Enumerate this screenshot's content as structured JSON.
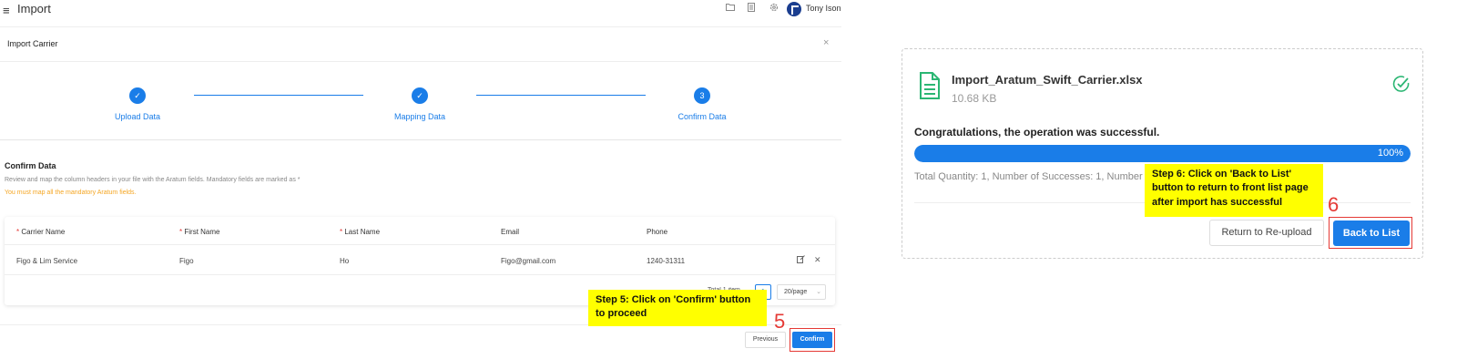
{
  "topbar": {
    "menu_icon": "≡",
    "app_title": "Import",
    "icons": [
      "folder-icon",
      "document-icon",
      "gear-icon"
    ],
    "user_name": "Tony Ison"
  },
  "modal": {
    "title": "Import Carrier",
    "close": "×"
  },
  "steps": [
    {
      "label": "Upload Data",
      "status": "done"
    },
    {
      "label": "Mapping Data",
      "status": "done"
    },
    {
      "label": "Confirm Data",
      "status": "current",
      "number": "3"
    }
  ],
  "confirm": {
    "title": "Confirm Data",
    "description": "Review and map the column headers in your file with the Aratum fields. Mandatory fields are marked as *",
    "warning": "You must map all the mandatory Aratum fields."
  },
  "table": {
    "columns": [
      {
        "label": "Carrier Name",
        "required": "*"
      },
      {
        "label": "First Name",
        "required": "*"
      },
      {
        "label": "Last Name",
        "required": "*"
      },
      {
        "label": "Email",
        "required": ""
      },
      {
        "label": "Phone",
        "required": ""
      }
    ],
    "rows": [
      {
        "carrier_name": "Figo & Lim Service",
        "first_name": "Figo",
        "last_name": "Ho",
        "email": "Figo@gmail.com",
        "phone": "1240-31311"
      }
    ]
  },
  "pagination": {
    "total_text": "Total 1 item",
    "current_page": "1",
    "page_size": "20/page"
  },
  "buttons": {
    "previous": "Previous",
    "confirm": "Confirm"
  },
  "annotations": {
    "step5_text": "Step 5: Click on 'Confirm' button to proceed",
    "step5_number": "5",
    "step6_text": "Step 6: Click on 'Back to List' button to return to front list page after import has successful",
    "step6_number": "6"
  },
  "result": {
    "file_name": "Import_Aratum_Swift_Carrier.xlsx",
    "file_size": "10.68 KB",
    "success_message": "Congratulations, the operation was successful.",
    "progress_percent": 100,
    "progress_label": "100%",
    "stats": "Total Quantity: 1, Number of Successes: 1, Number of Failures: 0",
    "reupload_label": "Return to Re-upload",
    "back_label": "Back to List"
  },
  "colors": {
    "primary": "#1a7de8",
    "callout": "#ffff00",
    "highlight": "#e53935",
    "warning": "#f5a623",
    "success": "#2bb673"
  }
}
